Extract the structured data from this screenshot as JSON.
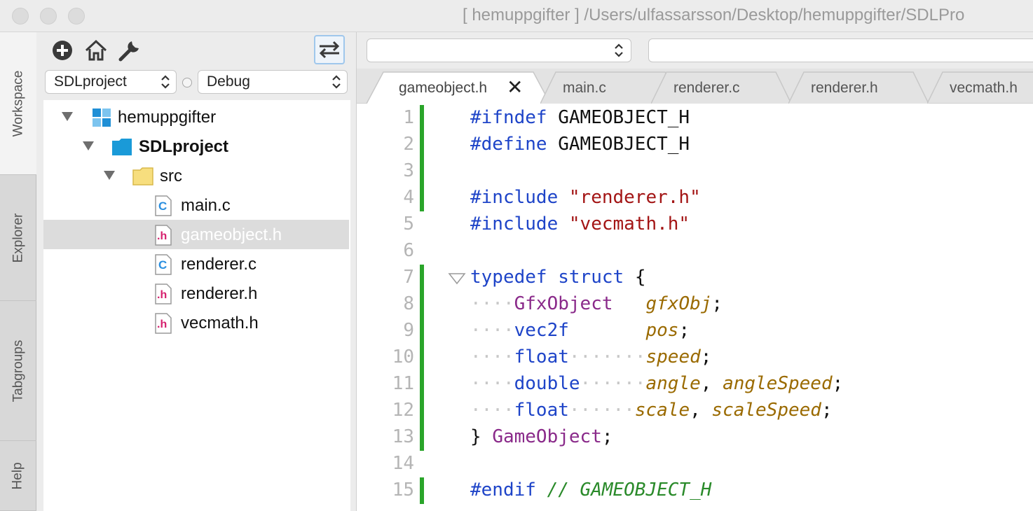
{
  "window": {
    "title": "[ hemuppgifter ] /Users/ulfassarsson/Desktop/hemuppgifter/SDLPro"
  },
  "side_tabs": [
    "Workspace",
    "Explorer",
    "Tabgroups",
    "Help"
  ],
  "workspace": {
    "project_select": "SDLproject",
    "config_select": "Debug",
    "tree": [
      {
        "label": "hemuppgifter",
        "type": "workspace"
      },
      {
        "label": "SDLproject",
        "type": "project"
      },
      {
        "label": "src",
        "type": "folder"
      },
      {
        "label": "main.c",
        "type": "c-file"
      },
      {
        "label": "gameobject.h",
        "type": "h-file",
        "selected": true
      },
      {
        "label": "renderer.c",
        "type": "c-file"
      },
      {
        "label": "renderer.h",
        "type": "h-file"
      },
      {
        "label": "vecmath.h",
        "type": "h-file"
      }
    ]
  },
  "editor": {
    "tabs": [
      {
        "label": "gameobject.h",
        "active": true
      },
      {
        "label": "main.c"
      },
      {
        "label": "renderer.c"
      },
      {
        "label": "renderer.h"
      },
      {
        "label": "vecmath.h"
      }
    ],
    "lines": [
      {
        "n": "1",
        "parts": [
          [
            "pp",
            "#ifndef"
          ],
          [
            "",
            "GAMEOBJECT_H"
          ]
        ]
      },
      {
        "n": "2",
        "parts": [
          [
            "pp",
            "#define"
          ],
          [
            "",
            "GAMEOBJECT_H"
          ]
        ]
      },
      {
        "n": "3",
        "parts": []
      },
      {
        "n": "4",
        "parts": [
          [
            "pp",
            "#include"
          ],
          [
            "str",
            "\"renderer.h\""
          ]
        ]
      },
      {
        "n": "5",
        "parts": [
          [
            "pp",
            "#include"
          ],
          [
            "str",
            "\"vecmath.h\""
          ]
        ]
      },
      {
        "n": "6",
        "parts": []
      },
      {
        "n": "7",
        "parts": [
          [
            "kw",
            "typedef"
          ],
          [
            "kw",
            "struct"
          ],
          [
            "",
            "{"
          ]
        ]
      },
      {
        "n": "8",
        "parts": [
          [
            "ty",
            "GfxObject"
          ],
          [
            "fld",
            "gfxObj"
          ],
          [
            "",
            ";"
          ]
        ]
      },
      {
        "n": "9",
        "parts": [
          [
            "kw",
            "vec2f"
          ],
          [
            "fld",
            "pos"
          ],
          [
            "",
            ";"
          ]
        ]
      },
      {
        "n": "10",
        "parts": [
          [
            "kw",
            "float"
          ],
          [
            "fld",
            "speed"
          ],
          [
            "",
            ";"
          ]
        ]
      },
      {
        "n": "11",
        "parts": [
          [
            "kw",
            "double"
          ],
          [
            "fld",
            "angle"
          ],
          [
            "",
            ","
          ],
          [
            "fld",
            "angleSpeed"
          ],
          [
            "",
            ";"
          ]
        ]
      },
      {
        "n": "12",
        "parts": [
          [
            "kw",
            "float"
          ],
          [
            "fld",
            "scale"
          ],
          [
            "",
            ","
          ],
          [
            "fld",
            "scaleSpeed"
          ],
          [
            "",
            ";"
          ]
        ]
      },
      {
        "n": "13",
        "parts": [
          [
            "",
            "}"
          ],
          [
            "ty",
            "GameObject"
          ],
          [
            "",
            ";"
          ]
        ]
      },
      {
        "n": "14",
        "parts": []
      },
      {
        "n": "15",
        "parts": [
          [
            "pp",
            "#endif"
          ],
          [
            "cm",
            "// GAMEOBJECT_H"
          ]
        ]
      }
    ]
  }
}
